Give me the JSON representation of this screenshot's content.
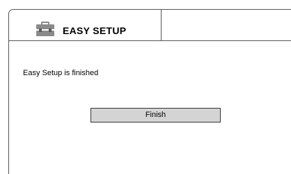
{
  "header": {
    "icon": "toolbox-icon",
    "title": "EASY SETUP"
  },
  "body": {
    "message": "Easy Setup is finished"
  },
  "actions": {
    "finish_label": "Finish"
  }
}
